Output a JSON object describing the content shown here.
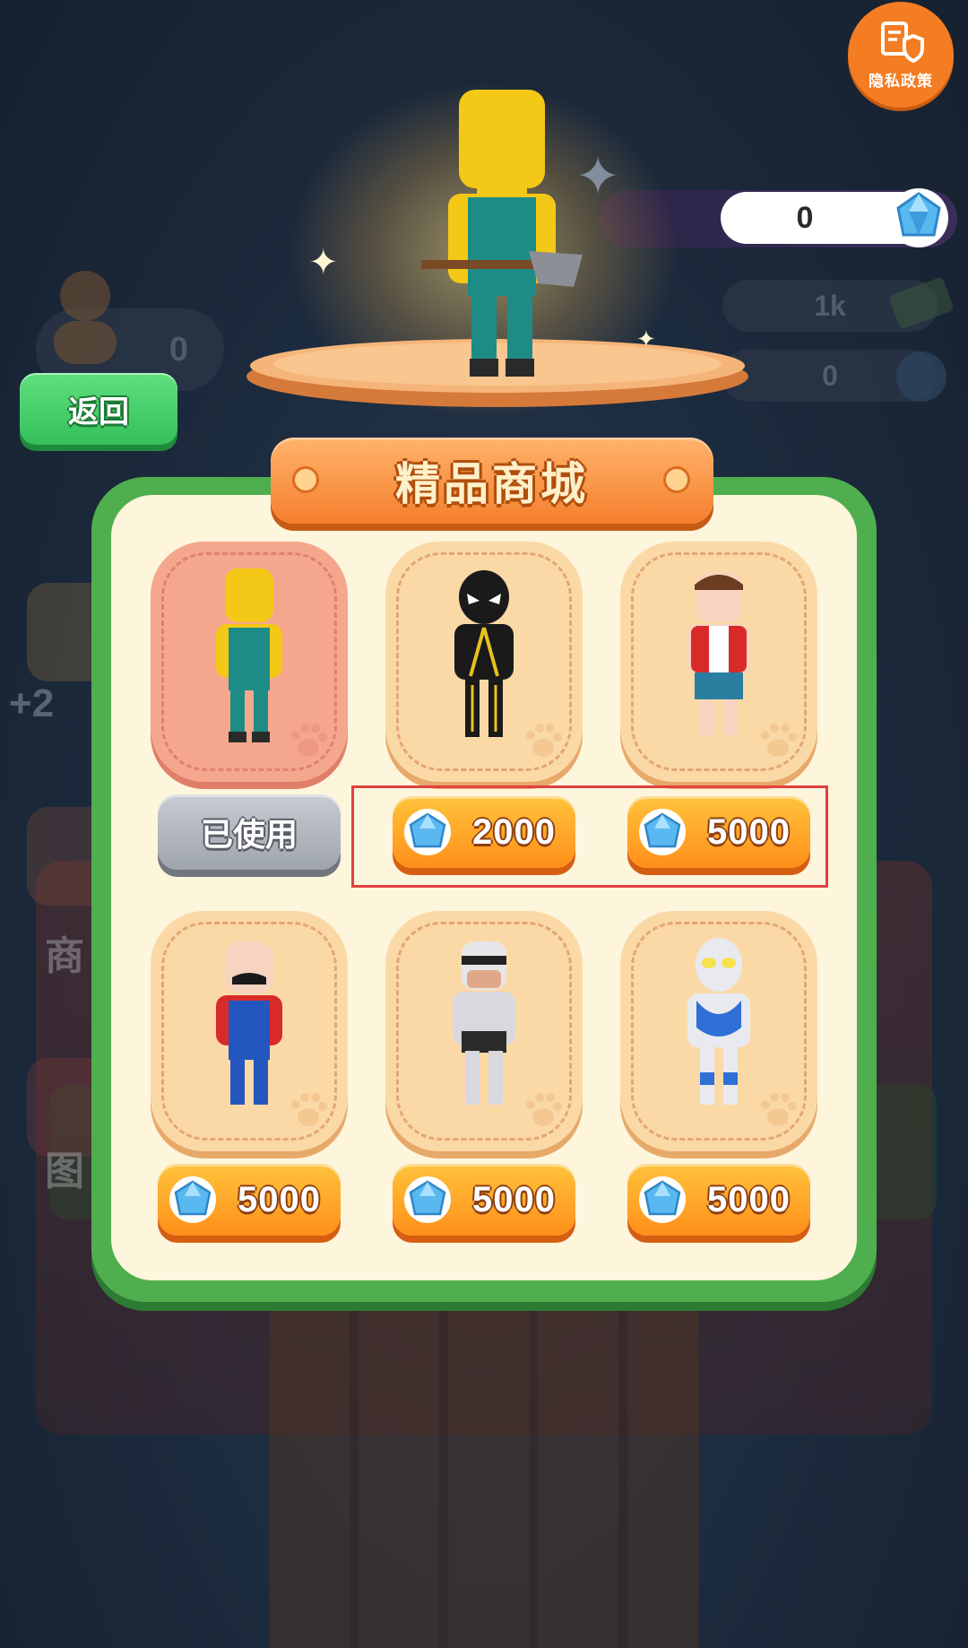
{
  "header": {
    "privacy_label": "隐私政策",
    "gem_count": "0",
    "cash_count": "1k",
    "coin_count": "0",
    "player_count": "0",
    "back_label": "返回"
  },
  "shop": {
    "title": "精品商城",
    "items": [
      {
        "name": "yellow-worker",
        "status": "已使用"
      },
      {
        "name": "black-spider",
        "price": "2000"
      },
      {
        "name": "red-vest-boy",
        "price": "5000"
      },
      {
        "name": "red-plumber",
        "price": "5000"
      },
      {
        "name": "robo-cop",
        "price": "5000"
      },
      {
        "name": "ultra-hero",
        "price": "5000"
      }
    ]
  },
  "colors": {
    "panel_green": "#4fae4e",
    "banner_orange": "#f57f2d",
    "price_orange": "#ff9f1f",
    "highlight_red": "#e24040"
  },
  "icons": [
    "privacy-doc-icon",
    "gem-icon",
    "cash-icon",
    "coin-icon",
    "avatar-icon",
    "paw-icon"
  ]
}
